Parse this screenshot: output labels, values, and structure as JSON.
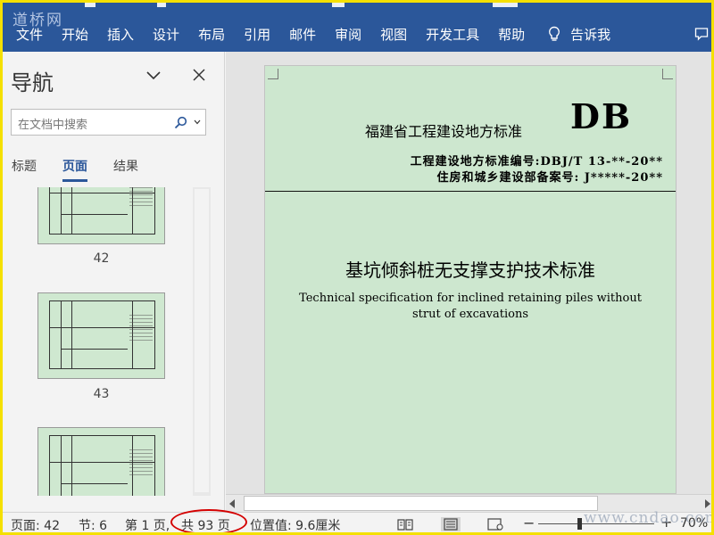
{
  "watermark": {
    "logo": "道桥网",
    "site": "www.cndao.com"
  },
  "ribbon": {
    "menu": [
      "文件",
      "开始",
      "插入",
      "设计",
      "布局",
      "引用",
      "邮件",
      "审阅",
      "视图",
      "开发工具",
      "帮助"
    ],
    "tell_me": "告诉我",
    "bg_color": "#2b579a"
  },
  "nav": {
    "title": "导航",
    "search_placeholder": "在文档中搜索",
    "tabs": [
      "标题",
      "页面",
      "结果"
    ],
    "active_tab": "页面",
    "thumbnails": [
      {
        "page": "42"
      },
      {
        "page": "43"
      },
      {
        "page": ""
      }
    ]
  },
  "document": {
    "org": "福建省工程建设地方标准",
    "db": "DB",
    "std_no": "工程建设地方标准编号:DBJ/T 13-**-20**",
    "record_no": "住房和城乡建设部备案号: J*****-20**",
    "title_cn": "基坑倾斜桩无支撑支护技术标准",
    "title_en_1": "Technical specification for inclined retaining piles without",
    "title_en_2": "strut of excavations",
    "page_color": "#cde7cf"
  },
  "status": {
    "page": "页面: 42",
    "section": "节: 6",
    "page_of": "第 1 页,",
    "total": "共 93 页",
    "position": "位置值: 9.6厘米",
    "zoom_minus": "−",
    "zoom_plus": "+",
    "zoom": "70%",
    "zoom_level": 0.35
  }
}
